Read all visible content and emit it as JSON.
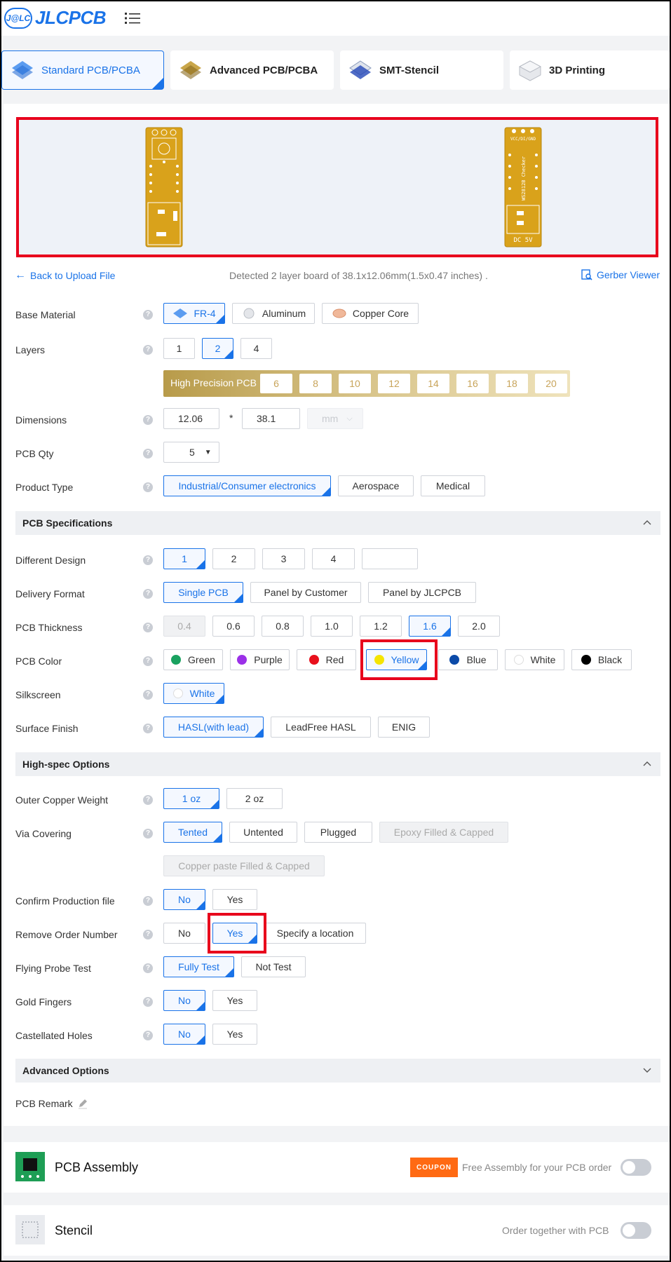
{
  "header": {
    "logo_badge": "J@LC",
    "logo_text": "JLCPCB"
  },
  "tabs": [
    {
      "label": "Standard PCB/PCBA",
      "active": true
    },
    {
      "label": "Advanced PCB/PCBA"
    },
    {
      "label": "SMT-Stencil"
    },
    {
      "label": "3D Printing"
    }
  ],
  "preview": {
    "front_label": "VCC/DI/GND",
    "back_text": "WS2812B Checker",
    "back_footer": "DC 5V"
  },
  "info": {
    "back_link": "Back to Upload File",
    "detected": "Detected 2 layer board of 38.1x12.06mm(1.5x0.47 inches) .",
    "gerber_viewer": "Gerber Viewer"
  },
  "help_glyph": "?",
  "base_material": {
    "label": "Base Material",
    "options": [
      "FR-4",
      "Aluminum",
      "Copper Core"
    ]
  },
  "layers": {
    "label": "Layers",
    "options": [
      "1",
      "2",
      "4"
    ]
  },
  "high_precision": {
    "label": "High Precision PCB",
    "options": [
      "6",
      "8",
      "10",
      "12",
      "14",
      "16",
      "18",
      "20"
    ]
  },
  "dimensions": {
    "label": "Dimensions",
    "width": "12.06",
    "separator": "*",
    "length": "38.1",
    "unit": "mm"
  },
  "pcb_qty": {
    "label": "PCB Qty",
    "value": "5"
  },
  "product_type": {
    "label": "Product Type",
    "options": [
      "Industrial/Consumer electronics",
      "Aerospace",
      "Medical"
    ]
  },
  "sections": {
    "pcb_spec": "PCB Specifications",
    "high_spec": "High-spec Options",
    "advanced": "Advanced Options"
  },
  "different_design": {
    "label": "Different Design",
    "options": [
      "1",
      "2",
      "3",
      "4",
      ""
    ]
  },
  "delivery_format": {
    "label": "Delivery Format",
    "options": [
      "Single PCB",
      "Panel by Customer",
      "Panel by JLCPCB"
    ]
  },
  "pcb_thickness": {
    "label": "PCB Thickness",
    "options": [
      "0.4",
      "0.6",
      "0.8",
      "1.0",
      "1.2",
      "1.6",
      "2.0"
    ]
  },
  "pcb_color": {
    "label": "PCB Color",
    "options": [
      {
        "name": "Green",
        "color": "#1aa260"
      },
      {
        "name": "Purple",
        "color": "#9b30e8"
      },
      {
        "name": "Red",
        "color": "#e8101c"
      },
      {
        "name": "Yellow",
        "color": "#f5e400"
      },
      {
        "name": "Blue",
        "color": "#0b4aa8"
      },
      {
        "name": "White",
        "color": "#ffffff"
      },
      {
        "name": "Black",
        "color": "#000000"
      }
    ]
  },
  "silkscreen": {
    "label": "Silkscreen",
    "value": "White"
  },
  "surface_finish": {
    "label": "Surface Finish",
    "options": [
      "HASL(with lead)",
      "LeadFree HASL",
      "ENIG"
    ]
  },
  "outer_copper": {
    "label": "Outer Copper Weight",
    "options": [
      "1 oz",
      "2 oz"
    ]
  },
  "via_covering": {
    "label": "Via Covering",
    "options": [
      "Tented",
      "Untented",
      "Plugged",
      "Epoxy Filled & Capped",
      "Copper paste Filled & Capped"
    ]
  },
  "confirm_production": {
    "label": "Confirm Production file",
    "options": [
      "No",
      "Yes"
    ]
  },
  "remove_order_number": {
    "label": "Remove Order Number",
    "options": [
      "No",
      "Yes",
      "Specify a location"
    ]
  },
  "flying_probe": {
    "label": "Flying Probe Test",
    "options": [
      "Fully Test",
      "Not Test"
    ]
  },
  "gold_fingers": {
    "label": "Gold Fingers",
    "options": [
      "No",
      "Yes"
    ]
  },
  "castellated": {
    "label": "Castellated Holes",
    "options": [
      "No",
      "Yes"
    ]
  },
  "pcb_remark": {
    "label": "PCB Remark"
  },
  "assembly": {
    "title": "PCB Assembly",
    "coupon": "COUPON",
    "note": "Free Assembly for your PCB order"
  },
  "stencil": {
    "title": "Stencil",
    "note": "Order together with PCB"
  },
  "colors": {
    "accent": "#1a73e8",
    "highlight": "#e8001c",
    "board": "#d9a21b"
  }
}
